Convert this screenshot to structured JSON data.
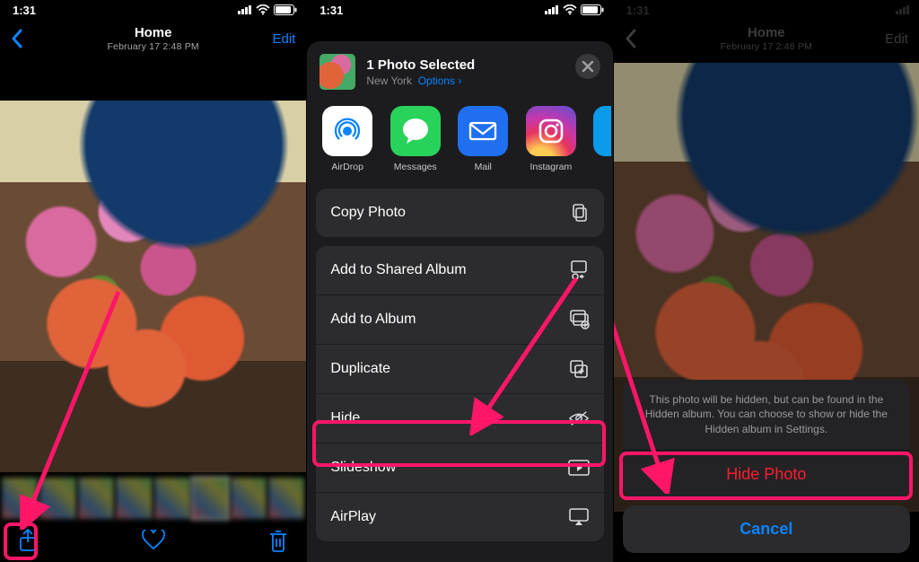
{
  "status": {
    "time": "1:31"
  },
  "p1": {
    "nav_title": "Home",
    "nav_sub": "February 17  2:48 PM",
    "edit": "Edit"
  },
  "sheet": {
    "title": "1 Photo Selected",
    "subtitle_location": "New York",
    "subtitle_options": "Options",
    "apps": [
      {
        "name": "AirDrop"
      },
      {
        "name": "Messages"
      },
      {
        "name": "Mail"
      },
      {
        "name": "Instagram"
      }
    ],
    "actions_group1": [
      {
        "label": "Copy Photo",
        "icon": "copy"
      }
    ],
    "actions_group2": [
      {
        "label": "Add to Shared Album",
        "icon": "shared-album"
      },
      {
        "label": "Add to Album",
        "icon": "album"
      },
      {
        "label": "Duplicate",
        "icon": "duplicate"
      },
      {
        "label": "Hide",
        "icon": "hide"
      },
      {
        "label": "Slideshow",
        "icon": "slideshow"
      },
      {
        "label": "AirPlay",
        "icon": "airplay"
      }
    ]
  },
  "p3": {
    "nav_title": "Home",
    "nav_sub": "February 17  2:48 PM",
    "edit": "Edit",
    "confirm_msg": "This photo will be hidden, but can be found in the Hidden album. You can choose to show or hide the Hidden album in Settings.",
    "hide_label": "Hide Photo",
    "cancel_label": "Cancel"
  },
  "colors": {
    "accent": "#0a84ff",
    "highlight": "#ff1669",
    "danger": "#ff1b2f"
  }
}
